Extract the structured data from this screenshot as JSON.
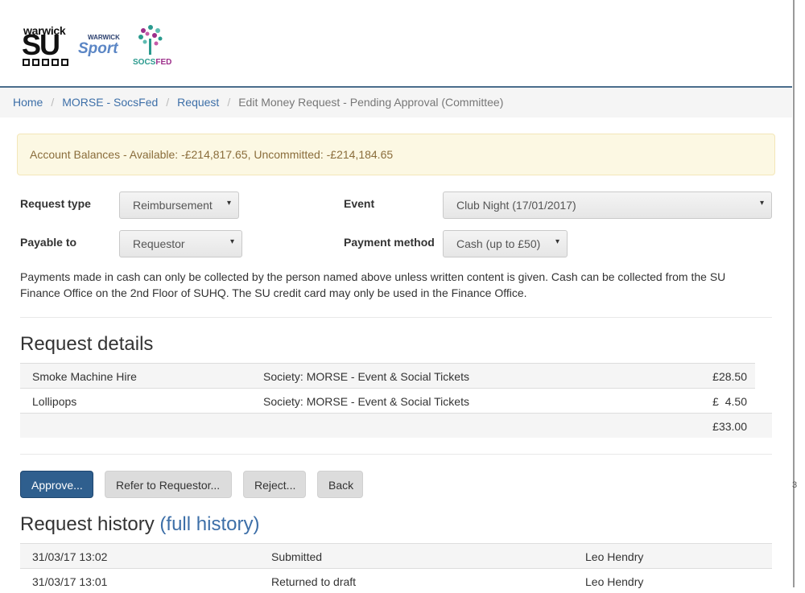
{
  "logos": {
    "su_top": "warwick",
    "su_main": "SU",
    "sport_top": "WARWICK",
    "sport_main": "Sport",
    "socsfed_a": "SOCS",
    "socsfed_b": "FED"
  },
  "breadcrumb": {
    "items": [
      "Home",
      "MORSE - SocsFed",
      "Request"
    ],
    "current": "Edit Money Request - Pending Approval (Committee)",
    "separator": "/"
  },
  "alert": {
    "text": "Account Balances - Available: -£214,817.65, Uncommitted: -£214,184.65"
  },
  "form": {
    "request_type": {
      "label": "Request type",
      "value": "Reimbursement"
    },
    "event": {
      "label": "Event",
      "value": "Club Night (17/01/2017)"
    },
    "payable_to": {
      "label": "Payable to",
      "value": "Requestor"
    },
    "payment_method": {
      "label": "Payment method",
      "value": "Cash (up to £50)"
    },
    "caret": "▾",
    "note": "Payments made in cash can only be collected by the person named above unless written content is given. Cash can be collected from the SU Finance Office on the 2nd Floor of SUHQ. The SU credit card may only be used in the Finance Office."
  },
  "request_details": {
    "heading": "Request details",
    "rows": [
      {
        "item": "Smoke Machine Hire",
        "budget": "Society: MORSE - Event & Social Tickets",
        "amount": "£28.50"
      },
      {
        "item": "Lollipops",
        "budget": "Society: MORSE - Event & Social Tickets",
        "amount": "£  4.50"
      }
    ],
    "total": "£33.00"
  },
  "buttons": {
    "approve": "Approve...",
    "refer": "Refer to Requestor...",
    "reject": "Reject...",
    "back": "Back"
  },
  "history": {
    "heading": "Request history",
    "link": "(full history)",
    "rows": [
      {
        "time": "31/03/17 13:02",
        "action": "Submitted",
        "user": "Leo Hendry"
      },
      {
        "time": "31/03/17 13:01",
        "action": "Returned to draft",
        "user": "Leo Hendry"
      }
    ]
  },
  "colors": {
    "primary": "#2f5f8e",
    "link": "#3d6fa8",
    "alert_bg": "#fcf8e3",
    "alert_text": "#8a6d3b"
  }
}
